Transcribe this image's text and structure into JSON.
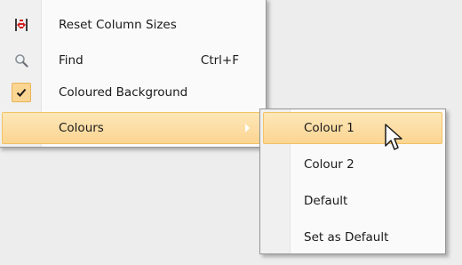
{
  "menu": {
    "items": [
      {
        "icon": "reset-columns-icon",
        "label": "Reset Column Sizes",
        "shortcut": ""
      },
      {
        "icon": "magnifier-icon",
        "label": "Find",
        "shortcut": "Ctrl+F"
      },
      {
        "icon": "checkmark-icon",
        "label": "Coloured Background",
        "shortcut": "",
        "checked": true
      },
      {
        "icon": "",
        "label": "Colours",
        "shortcut": "",
        "has_submenu": true,
        "highlighted": true
      }
    ]
  },
  "submenu": {
    "items": [
      {
        "label": "Colour 1",
        "highlighted": true
      },
      {
        "label": "Colour 2"
      },
      {
        "label": "Default"
      },
      {
        "label": "Set as Default"
      }
    ]
  },
  "colors": {
    "highlight_top": "#fde7b8",
    "highlight_bottom": "#fbd592",
    "highlight_border": "#f3c264",
    "menu_bg": "#fafafa",
    "gutter_bg": "#f0f0f0"
  },
  "cursor": "arrow-pointer-icon"
}
